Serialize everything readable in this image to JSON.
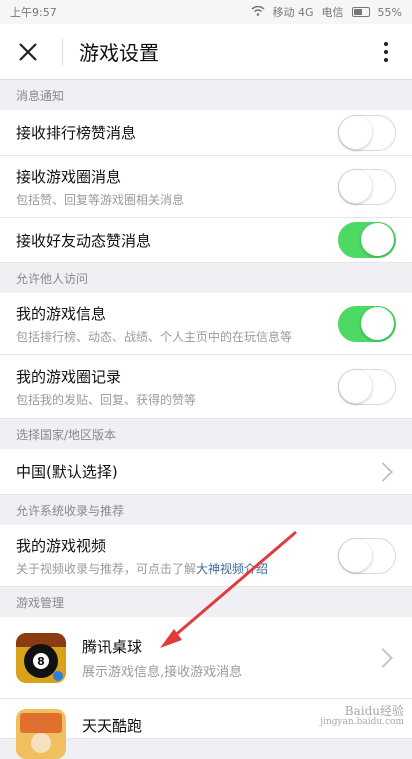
{
  "status": {
    "time": "上午9:57",
    "carrier1": "移动 4G",
    "carrier2": "电信",
    "battery": "55%"
  },
  "header": {
    "title": "游戏设置"
  },
  "sections": {
    "notifications": "消息通知",
    "visitors": "允许他人访问",
    "region": "选择国家/地区版本",
    "recommend": "允许系统收录与推荐",
    "manage": "游戏管理"
  },
  "rows": {
    "rank_like": {
      "label": "接收排行榜赞消息",
      "on": false
    },
    "circle_msg": {
      "label": "接收游戏圈消息",
      "sub": "包括赞、回复等游戏圈相关消息",
      "on": false
    },
    "friend_like": {
      "label": "接收好友动态赞消息",
      "on": true
    },
    "my_info": {
      "label": "我的游戏信息",
      "sub": "包括排行榜、动态、战绩、个人主页中的在玩信息等",
      "on": true
    },
    "circle_record": {
      "label": "我的游戏圈记录",
      "sub": "包括我的发贴、回复、获得的赞等",
      "on": false
    },
    "region_choice": {
      "label": "中国(默认选择)"
    },
    "my_video": {
      "label": "我的游戏视频",
      "sub_prefix": "关于视频收录与推荐，可点击了解",
      "sub_link": "大神视频介绍",
      "on": false
    }
  },
  "games": [
    {
      "name": "腾讯桌球",
      "desc": "展示游戏信息,接收游戏消息",
      "icon": "billiards-game-icon"
    },
    {
      "name": "天天酷跑",
      "desc": "",
      "icon": "parkour-game-icon"
    }
  ],
  "watermark": {
    "line1": "Baidu经验",
    "line2": "jingyan.baidu.com"
  },
  "colors": {
    "toggle_on": "#4cd964",
    "link": "#3b6aa0",
    "arrow": "#e23b3b"
  }
}
